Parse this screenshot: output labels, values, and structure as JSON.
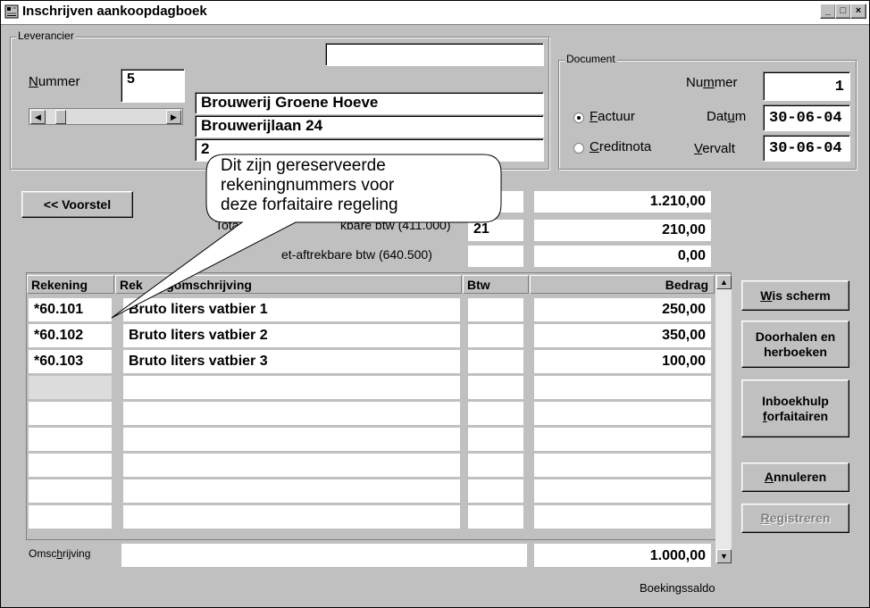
{
  "window": {
    "title": "Inschrijven aankoopdagboek"
  },
  "leverancier": {
    "group_label": "Leverancier",
    "nummer_label": "Nummer",
    "nummer_value": "5",
    "naam": "Brouwerij Groene Hoeve",
    "adres": "Brouwerijlaan 24",
    "postcode_partial": "2",
    "extra": ""
  },
  "document": {
    "group_label": "Document",
    "nummer_label": "Nummer",
    "nummer_value": "1",
    "factuur_label": "Factuur",
    "creditnota_label": "Creditnota",
    "datum_label": "Datum",
    "datum_value": "30-06-04",
    "vervalt_label": "Vervalt",
    "vervalt_value": "30-06-04",
    "selected": "Factuur"
  },
  "voorstel_button": "<< Voorstel",
  "totals": {
    "total_value": "1.210,00",
    "aftrek_label": "Totaal aftrekbare btw (411.000)",
    "aftrek_label_visible": "Tota",
    "aftrek_label_tail": "kbare btw (411.000)",
    "aftrek_btw": "21",
    "aftrek_value": "210,00",
    "niet_label_tail": "et-aftrekbare btw (640.500)",
    "niet_value": "0,00"
  },
  "callout": {
    "lines": [
      "Dit zijn gereserveerde",
      "rekeningnummers voor",
      "deze forfaitaire regeling"
    ]
  },
  "table": {
    "headers": {
      "rekening": "Rekening",
      "omschrijving_a": "Rek",
      "omschrijving_b": "ngomschrijving",
      "btw": "Btw",
      "bedrag": "Bedrag"
    },
    "rows": [
      {
        "rekening": "*60.101",
        "omschrijving": "Bruto liters vatbier 1",
        "btw": "",
        "bedrag": "250,00"
      },
      {
        "rekening": "*60.102",
        "omschrijving": "Bruto liters vatbier 2",
        "btw": "",
        "bedrag": "350,00"
      },
      {
        "rekening": "*60.103",
        "omschrijving": "Bruto liters vatbier 3",
        "btw": "",
        "bedrag": "100,00"
      },
      {
        "rekening": "",
        "omschrijving": "",
        "btw": "",
        "bedrag": ""
      },
      {
        "rekening": "",
        "omschrijving": "",
        "btw": "",
        "bedrag": ""
      },
      {
        "rekening": "",
        "omschrijving": "",
        "btw": "",
        "bedrag": ""
      },
      {
        "rekening": "",
        "omschrijving": "",
        "btw": "",
        "bedrag": ""
      },
      {
        "rekening": "",
        "omschrijving": "",
        "btw": "",
        "bedrag": ""
      },
      {
        "rekening": "",
        "omschrijving": "",
        "btw": "",
        "bedrag": ""
      }
    ]
  },
  "omschrijving": {
    "label": "Omschrijving",
    "value": ""
  },
  "saldo": {
    "value": "1.000,00",
    "label": "Boekingssaldo"
  },
  "buttons": {
    "wis": "Wis scherm",
    "doorhalen": "Doorhalen en herboeken",
    "inboekhulp": "Inboekhulp forfaitairen",
    "annuleren": "Annuleren",
    "registreren": "Registreren"
  }
}
